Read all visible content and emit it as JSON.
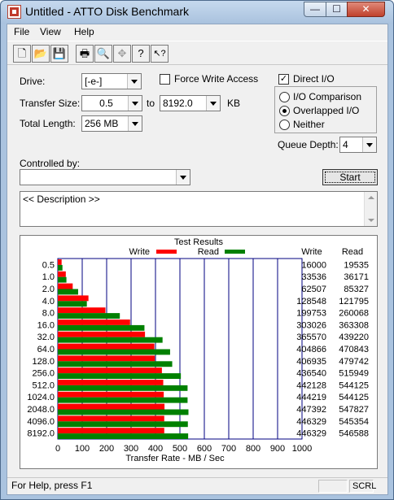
{
  "window": {
    "title": "Untitled - ATTO Disk Benchmark",
    "min_glyph": "—",
    "max_glyph": "☐",
    "close_glyph": "✕"
  },
  "menu": [
    {
      "label": "File"
    },
    {
      "label": "View"
    },
    {
      "label": "Help"
    }
  ],
  "toolbar": {
    "buttons": [
      {
        "icon": "new-document-icon",
        "glyph": "🗋"
      },
      {
        "icon": "open-folder-icon",
        "glyph": "📂"
      },
      {
        "icon": "save-icon",
        "glyph": "💾"
      },
      {
        "icon": "print-icon",
        "glyph": "🖶"
      },
      {
        "icon": "print-preview-icon",
        "glyph": "🔍"
      },
      {
        "icon": "move-icon",
        "glyph": "✥",
        "disabled": true
      },
      {
        "icon": "help-icon",
        "glyph": "?"
      },
      {
        "icon": "context-help-icon",
        "glyph": "↖?"
      }
    ]
  },
  "settings": {
    "drive_label": "Drive:",
    "drive_value": "[-e-]",
    "force_write_label": "Force Write Access",
    "force_write_checked": false,
    "direct_io_label": "Direct I/O",
    "direct_io_checked": true,
    "direct_io_mark": "✓",
    "transfer_size_label": "Transfer Size:",
    "transfer_from": "0.5",
    "transfer_to_label": "to",
    "transfer_to": "8192.0",
    "transfer_unit": "KB",
    "total_length_label": "Total Length:",
    "total_length_value": "256 MB",
    "io_modes": [
      {
        "label": "I/O Comparison",
        "selected": false
      },
      {
        "label": "Overlapped I/O",
        "selected": true
      },
      {
        "label": "Neither",
        "selected": false
      }
    ],
    "queue_depth_label": "Queue Depth:",
    "queue_depth_value": "4",
    "controlled_by_label": "Controlled by:",
    "controlled_by_value": "",
    "start_label": "Start",
    "description_text": "<< Description >>"
  },
  "results": {
    "title": "Test Results",
    "legend_write": "Write",
    "legend_read": "Read",
    "write_header": "Write",
    "read_header": "Read",
    "colors": {
      "write": "#ff0000",
      "read": "#008000",
      "grid": "#000080"
    }
  },
  "chart_data": {
    "type": "bar",
    "title": "Test Results",
    "xlabel": "Transfer Rate - MB / Sec",
    "xlim": [
      0,
      1000
    ],
    "xticks": [
      0,
      100,
      200,
      300,
      400,
      500,
      600,
      700,
      800,
      900,
      1000
    ],
    "categories": [
      "0.5",
      "1.0",
      "2.0",
      "4.0",
      "8.0",
      "16.0",
      "32.0",
      "64.0",
      "128.0",
      "256.0",
      "512.0",
      "1024.0",
      "2048.0",
      "4096.0",
      "8192.0"
    ],
    "series": [
      {
        "name": "Write",
        "color": "#ff0000",
        "values": [
          16000,
          33536,
          62507,
          128548,
          199753,
          303026,
          365570,
          404866,
          406935,
          436540,
          442128,
          444219,
          447392,
          446329,
          446329
        ]
      },
      {
        "name": "Read",
        "color": "#008000",
        "values": [
          19535,
          36171,
          85327,
          121795,
          260068,
          363308,
          439220,
          470843,
          479742,
          515949,
          544125,
          544125,
          547827,
          545354,
          546588
        ]
      }
    ],
    "grid": true,
    "orientation": "horizontal"
  },
  "status": {
    "help_text": "For Help, press F1",
    "indicator": "SCRL"
  }
}
